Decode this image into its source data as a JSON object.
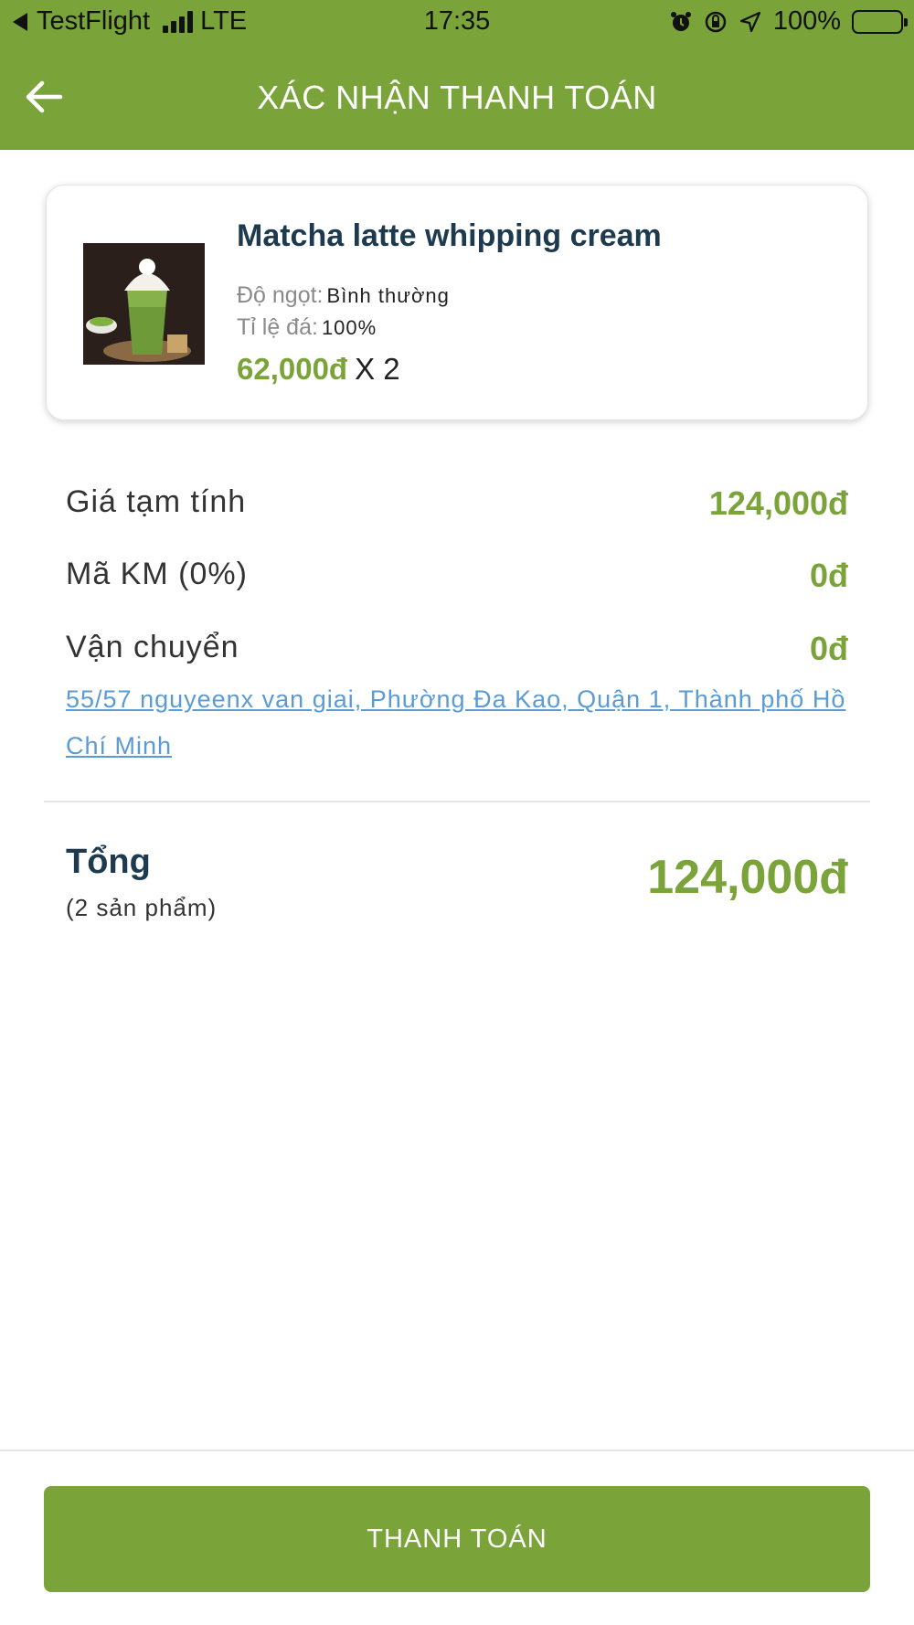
{
  "status_bar": {
    "carrier": "TestFlight",
    "network": "LTE",
    "time": "17:35",
    "battery": "100%"
  },
  "header": {
    "title": "XÁC NHẬN THANH TOÁN",
    "back_icon": "arrow-left-icon"
  },
  "product": {
    "name": "Matcha latte whipping cream",
    "sweetness_label": "Độ ngọt:",
    "sweetness_value": "Bình thường",
    "ice_label": "Tỉ lệ đá:",
    "ice_value": "100%",
    "price": "62,000đ",
    "quantity": "X 2"
  },
  "summary": {
    "subtotal_label": "Giá tạm tính",
    "subtotal_value": "124,000đ",
    "promo_label": "Mã KM (0%)",
    "promo_value": "0đ",
    "shipping_label": "Vận chuyển",
    "shipping_value": "0đ",
    "address": "55/57 nguyeenx van giai, Phường Đa Kao, Quận 1, Thành phố Hồ Chí Minh"
  },
  "total": {
    "label": "Tổng",
    "count": "(2 sản phẩm)",
    "value": "124,000đ"
  },
  "actions": {
    "pay_label": "THANH TOÁN"
  },
  "colors": {
    "primary": "#7aa33a",
    "title_text": "#1d3a4e",
    "link": "#5b9bd5"
  }
}
